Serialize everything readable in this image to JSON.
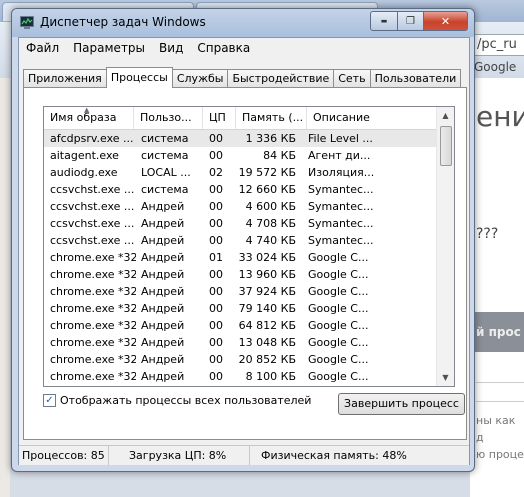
{
  "background": {
    "url_text": "/pc_ru",
    "google_label": "Google",
    "page_heading": "ени",
    "page_question": "???",
    "dark_banner": "й прос",
    "text_lines": [
      "ны как д",
      "ю проце"
    ]
  },
  "window": {
    "title": "Диспетчер задач Windows",
    "min_label": "▬",
    "max_label": "❐",
    "close_label": "✕"
  },
  "menu": [
    "Файл",
    "Параметры",
    "Вид",
    "Справка"
  ],
  "tabs": [
    "Приложения",
    "Процессы",
    "Службы",
    "Быстродействие",
    "Сеть",
    "Пользователи"
  ],
  "active_tab": "Процессы",
  "columns": {
    "name": "Имя образа",
    "user": "Пользо...",
    "cpu": "ЦП",
    "mem": "Память (...",
    "desc": "Описание"
  },
  "processes": [
    {
      "name": "afcdpsrv.exe ...",
      "user": "система",
      "cpu": "00",
      "mem": "1 336 КБ",
      "desc": "File Level ..."
    },
    {
      "name": "aitagent.exe",
      "user": "система",
      "cpu": "00",
      "mem": "84 КБ",
      "desc": "Агент ди..."
    },
    {
      "name": "audiodg.exe",
      "user": "LOCAL ...",
      "cpu": "02",
      "mem": "19 572 КБ",
      "desc": "Изоляция..."
    },
    {
      "name": "ccsvchst.exe ...",
      "user": "система",
      "cpu": "00",
      "mem": "12 660 КБ",
      "desc": "Symantec..."
    },
    {
      "name": "ccsvchst.exe ...",
      "user": "Андрей",
      "cpu": "00",
      "mem": "4 600 КБ",
      "desc": "Symantec..."
    },
    {
      "name": "ccsvchst.exe ...",
      "user": "Андрей",
      "cpu": "00",
      "mem": "4 708 КБ",
      "desc": "Symantec..."
    },
    {
      "name": "ccsvchst.exe ...",
      "user": "Андрей",
      "cpu": "00",
      "mem": "4 740 КБ",
      "desc": "Symantec..."
    },
    {
      "name": "chrome.exe *32",
      "user": "Андрей",
      "cpu": "01",
      "mem": "33 024 КБ",
      "desc": "Google C..."
    },
    {
      "name": "chrome.exe *32",
      "user": "Андрей",
      "cpu": "00",
      "mem": "13 960 КБ",
      "desc": "Google C..."
    },
    {
      "name": "chrome.exe *32",
      "user": "Андрей",
      "cpu": "00",
      "mem": "37 924 КБ",
      "desc": "Google C..."
    },
    {
      "name": "chrome.exe *32",
      "user": "Андрей",
      "cpu": "00",
      "mem": "79 140 КБ",
      "desc": "Google C..."
    },
    {
      "name": "chrome.exe *32",
      "user": "Андрей",
      "cpu": "00",
      "mem": "64 812 КБ",
      "desc": "Google C..."
    },
    {
      "name": "chrome.exe *32",
      "user": "Андрей",
      "cpu": "00",
      "mem": "13 048 КБ",
      "desc": "Google C..."
    },
    {
      "name": "chrome.exe *32",
      "user": "Андрей",
      "cpu": "00",
      "mem": "20 852 КБ",
      "desc": "Google C..."
    },
    {
      "name": "chrome.exe *32",
      "user": "Андрей",
      "cpu": "00",
      "mem": "8 100 КБ",
      "desc": "Google C..."
    }
  ],
  "selected_row_index": 0,
  "show_all_users": {
    "label": "Отображать процессы всех пользователей",
    "checked": true
  },
  "end_process_label": "Завершить процесс",
  "status": {
    "processes": "Процессов: 85",
    "cpu": "Загрузка ЦП: 8%",
    "memory": "Физическая память: 48%"
  }
}
